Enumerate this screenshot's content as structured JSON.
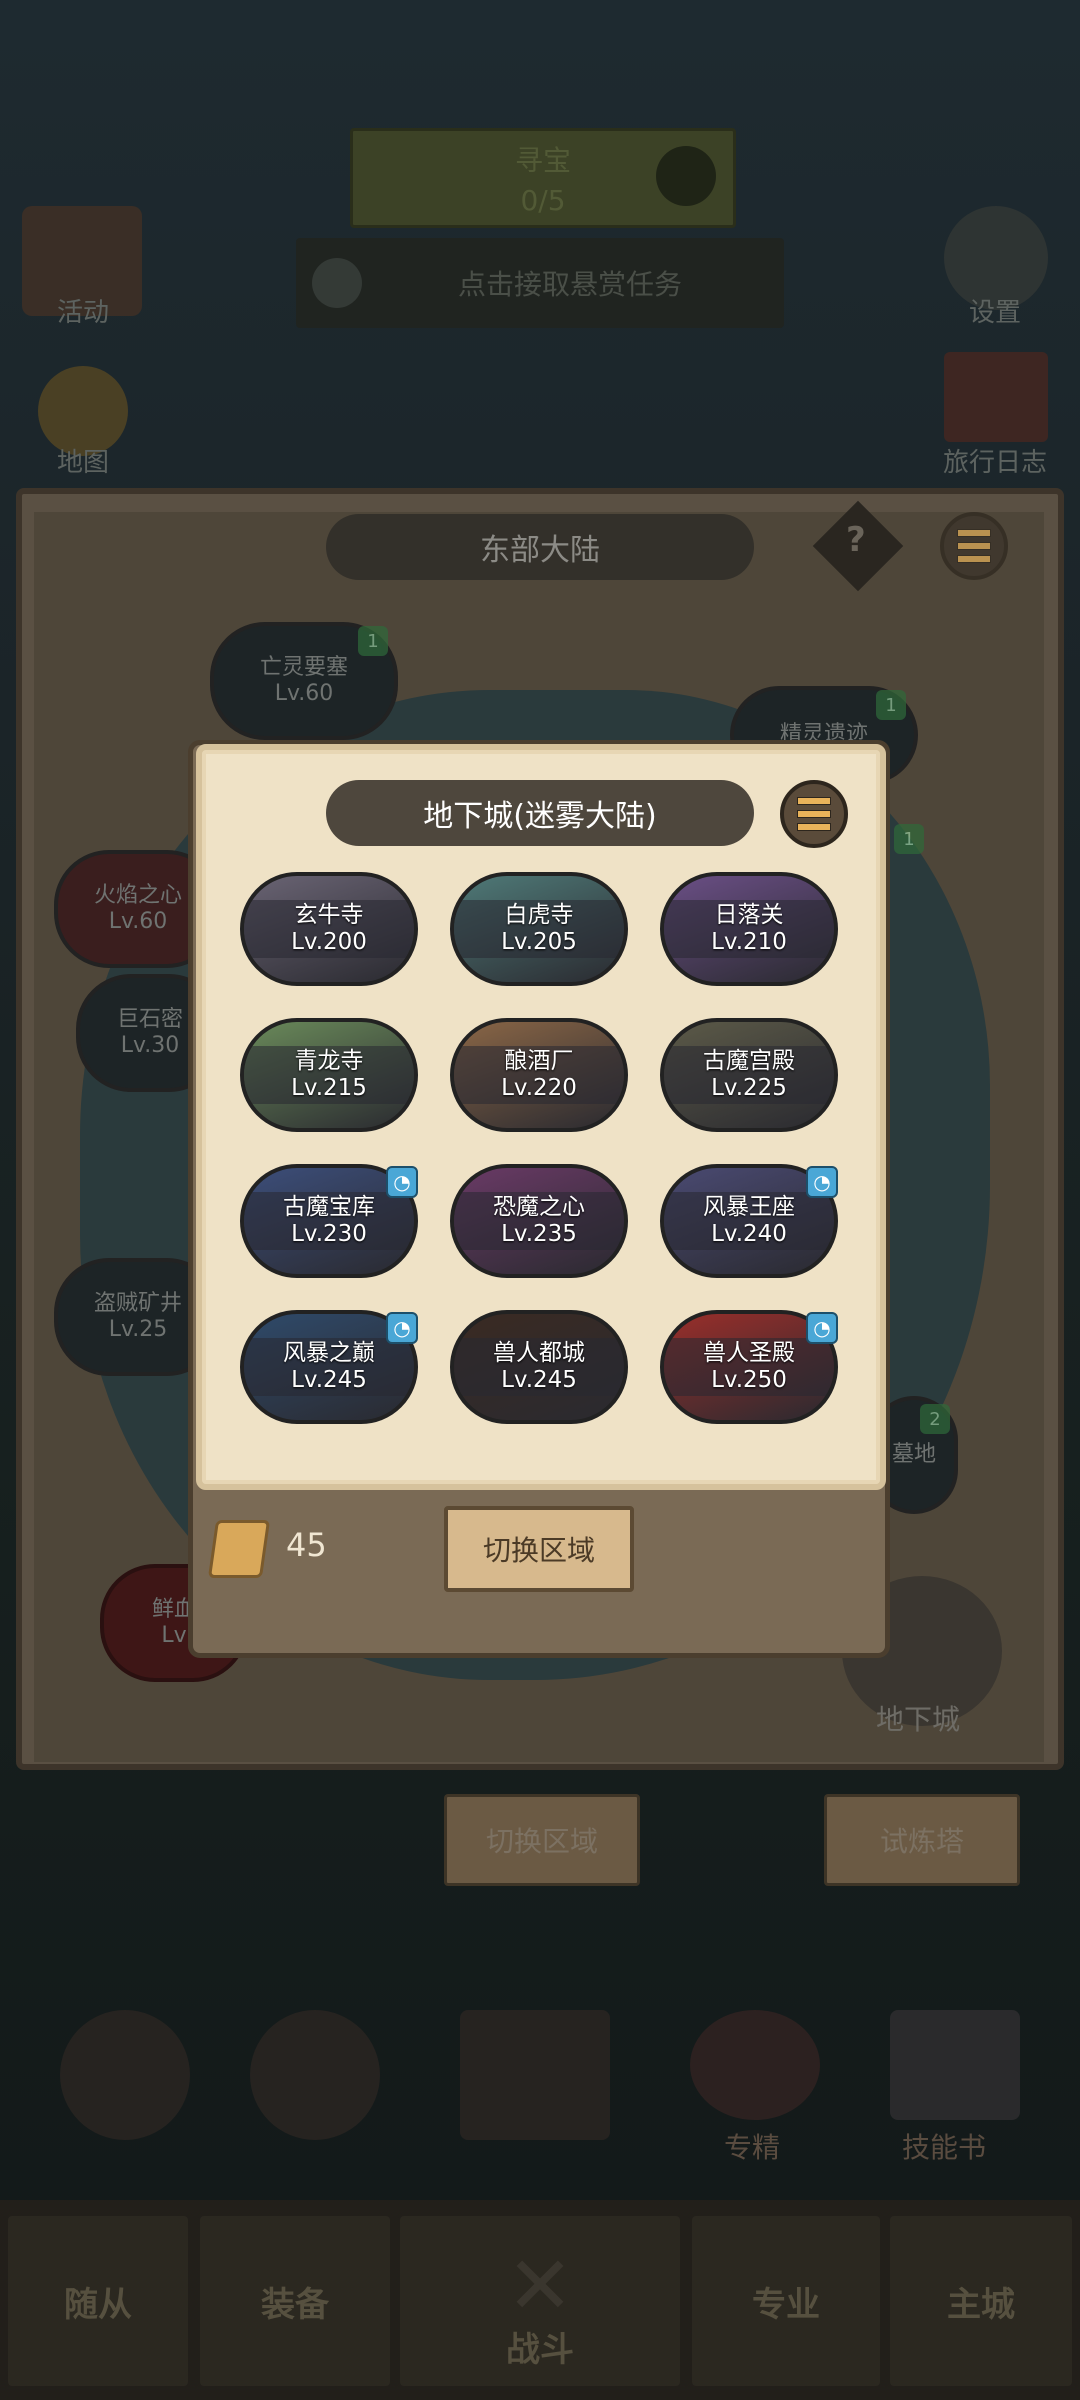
{
  "background": {
    "top_banner_text": "寻宝",
    "top_banner_sub": "0/5",
    "bounty_text": "点击接取悬赏任务",
    "left_icons": [
      "活动",
      "地图"
    ],
    "right_icons": [
      "设置",
      "旅行日志"
    ]
  },
  "map": {
    "region_title": "东部大陆",
    "help_label": "?",
    "nodes": [
      {
        "name": "亡灵要塞",
        "level": "Lv.60",
        "badge": "1"
      },
      {
        "name": "精灵遗迹",
        "level": "",
        "badge": "1"
      },
      {
        "name": "火焰之心",
        "level": "Lv.60",
        "badge": ""
      },
      {
        "name": "巨石密",
        "level": "Lv.30",
        "badge": ""
      },
      {
        "name": "盗贼矿井",
        "level": "Lv.25",
        "badge": ""
      },
      {
        "name": "鲜血",
        "level": "Lv",
        "badge": ""
      },
      {
        "name": "墓地",
        "level": "",
        "badge": "2"
      }
    ],
    "dungeon_button_label": "地下城",
    "switch_region_label": "切换区域",
    "trial_tower_label": "试炼塔"
  },
  "bottom_actions": [
    "专精",
    "技能书"
  ],
  "tabs": [
    "随从",
    "装备",
    "战斗",
    "专业",
    "主城"
  ],
  "modal": {
    "title": "地下城(迷雾大陆)",
    "dungeons": [
      {
        "name": "玄牛寺",
        "level": "Lv.200",
        "swirl": false,
        "color": "#6a6474"
      },
      {
        "name": "白虎寺",
        "level": "Lv.205",
        "swirl": false,
        "color": "#4f7a78"
      },
      {
        "name": "日落关",
        "level": "Lv.210",
        "swirl": false,
        "color": "#6b4f86"
      },
      {
        "name": "青龙寺",
        "level": "Lv.215",
        "swirl": false,
        "color": "#6a8a5a"
      },
      {
        "name": "酿酒厂",
        "level": "Lv.220",
        "swirl": false,
        "color": "#8a6646"
      },
      {
        "name": "古魔宫殿",
        "level": "Lv.225",
        "swirl": false,
        "color": "#5c5a48"
      },
      {
        "name": "古魔宝库",
        "level": "Lv.230",
        "swirl": true,
        "color": "#3c4e7a"
      },
      {
        "name": "恐魔之心",
        "level": "Lv.235",
        "swirl": false,
        "color": "#6a3a66"
      },
      {
        "name": "风暴王座",
        "level": "Lv.240",
        "swirl": true,
        "color": "#4a4a72"
      },
      {
        "name": "风暴之巅",
        "level": "Lv.245",
        "swirl": true,
        "color": "#2f4a6a"
      },
      {
        "name": "兽人都城",
        "level": "Lv.245",
        "swirl": false,
        "color": "#3a2a22"
      },
      {
        "name": "兽人圣殿",
        "level": "Lv.250",
        "swirl": true,
        "color": "#9a2e2a"
      }
    ],
    "ticket_count": "45",
    "switch_button": "切换区域"
  },
  "colors": {
    "paper": "#efe2c6",
    "frame": "#7a6a55",
    "accent": "#e9b35a"
  }
}
